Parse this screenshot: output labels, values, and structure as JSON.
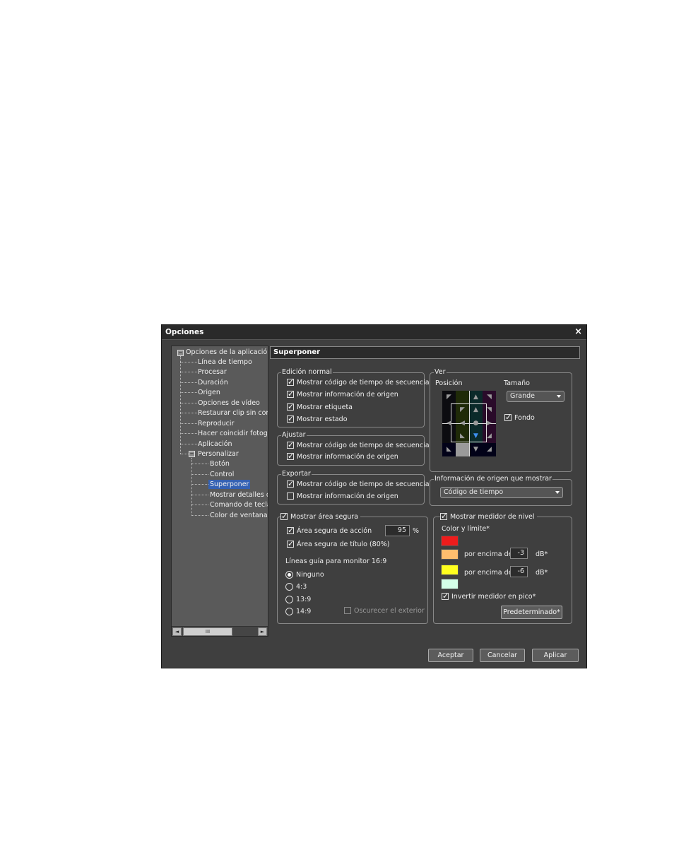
{
  "window": {
    "title": "Opciones",
    "close": "×"
  },
  "tree": {
    "root": "Opciones de la aplicación",
    "items": [
      "Línea de tiempo",
      "Procesar",
      "Duración",
      "Origen",
      "Opciones de vídeo",
      "Restaurar clip sin conexión",
      "Reproducir",
      "Hacer coincidir fotograma",
      "Aplicación"
    ],
    "personalizar": "Personalizar",
    "sub_items": [
      "Botón",
      "Control",
      "Superponer",
      "Mostrar detalles de",
      "Comando de teclado",
      "Color de ventana"
    ],
    "selected": "Superponer",
    "expand_glyph": "−"
  },
  "scroll": {
    "left": "◄",
    "thumb": "III",
    "right": "►"
  },
  "panel": {
    "header": "Superponer"
  },
  "edicion_normal": {
    "legend": "Edición normal",
    "items": [
      {
        "label": "Mostrar código de tiempo de secuencia",
        "checked": true
      },
      {
        "label": "Mostrar información de origen",
        "checked": true
      },
      {
        "label": "Mostrar etiqueta",
        "checked": true
      },
      {
        "label": "Mostrar estado",
        "checked": true
      }
    ]
  },
  "ajustar": {
    "legend": "Ajustar",
    "items": [
      {
        "label": "Mostrar código de tiempo de secuencia",
        "checked": true
      },
      {
        "label": "Mostrar información de origen",
        "checked": true
      }
    ]
  },
  "exportar": {
    "legend": "Exportar",
    "items": [
      {
        "label": "Mostrar código de tiempo de secuencia",
        "checked": true
      },
      {
        "label": "Mostrar información de origen",
        "checked": false
      }
    ]
  },
  "ver": {
    "legend": "Ver",
    "posicion": "Posición",
    "tamano": "Tamaño",
    "tamano_value": "Grande",
    "fondo": "Fondo",
    "fondo_checked": true
  },
  "info_origen": {
    "legend": "Información de origen que mostrar",
    "value": "Código de tiempo"
  },
  "area_segura": {
    "legend": "Mostrar área segura",
    "checked": true,
    "accion_label": "Área segura de acción",
    "accion_value": "95",
    "accion_unit": "%",
    "titulo_label": "Área segura de título (80%)",
    "lineas_label": "Líneas guía para monitor 16:9",
    "radios": [
      {
        "label": "Ninguno",
        "on": true
      },
      {
        "label": "4:3",
        "on": false
      },
      {
        "label": "13:9",
        "on": false
      },
      {
        "label": "14:9",
        "on": false
      }
    ],
    "oscurecer": "Oscurecer el exterior"
  },
  "medidor": {
    "legend": "Mostrar medidor de nivel",
    "checked": true,
    "color_label": "Color y límite*",
    "colors": [
      "#ee1c1c",
      "#ffbe6e",
      "#ffff1e",
      "#d4ffe8"
    ],
    "por_encima_1": "por encima de",
    "value_1": "-3",
    "unit_1": "dB*",
    "por_encima_2": "por encima de",
    "value_2": "-6",
    "unit_2": "dB*",
    "invertir": "Invertir medidor en pico*",
    "predeterminado": "Predeterminado*"
  },
  "buttons": {
    "aceptar": "Aceptar",
    "cancelar": "Cancelar",
    "aplicar": "Aplicar"
  }
}
